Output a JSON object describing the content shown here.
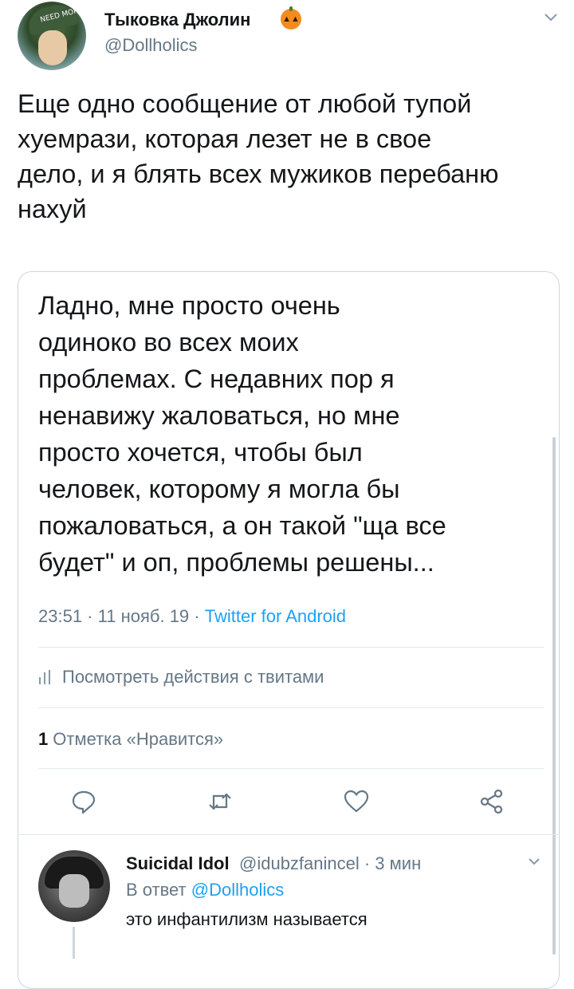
{
  "tweet": {
    "display_name": "Тыковка Джолин",
    "handle": "@Dollholics",
    "avatar_cap_text": "NEED MORN",
    "text_lines": [
      "Еще одно сообщение от любой тупой",
      "хуемрази, которая лезет не в свое",
      "дело, и я блять всех мужиков перебаню",
      "нахуй"
    ]
  },
  "quoted": {
    "text_lines": [
      "Ладно, мне просто очень",
      "одиноко во всех моих",
      "проблемах. С недавних пор я",
      "ненавижу жаловаться, но мне",
      "просто хочется, чтобы был",
      "человек, которому я могла бы",
      "пожаловаться, а он такой \"ща все",
      "будет\" и оп, проблемы решены..."
    ],
    "time": "23:51",
    "date": "11 нояб. 19",
    "separator": " · ",
    "source": "Twitter for Android",
    "activity_label": "Посмотреть действия с твитами",
    "likes_count": "1",
    "likes_label": "Отметка «Нравится»"
  },
  "reply": {
    "display_name": "Suicidal Idol",
    "handle_time": "@idubzfanincel · 3 мин",
    "reply_prefix": "В ответ",
    "reply_mention": "@Dollholics",
    "text": "это инфантилизм называется"
  },
  "icons": {
    "pumpkin": "jack-o-lantern-icon",
    "reply": "reply-icon",
    "retweet": "retweet-icon",
    "like": "heart-icon",
    "share": "share-icon",
    "activity": "bar-chart-icon",
    "menu": "chevron-down-icon"
  },
  "colors": {
    "accent": "#1da1f2",
    "secondary_text": "#657786",
    "primary_text": "#14171a",
    "pumpkin": "#f28c1e"
  }
}
